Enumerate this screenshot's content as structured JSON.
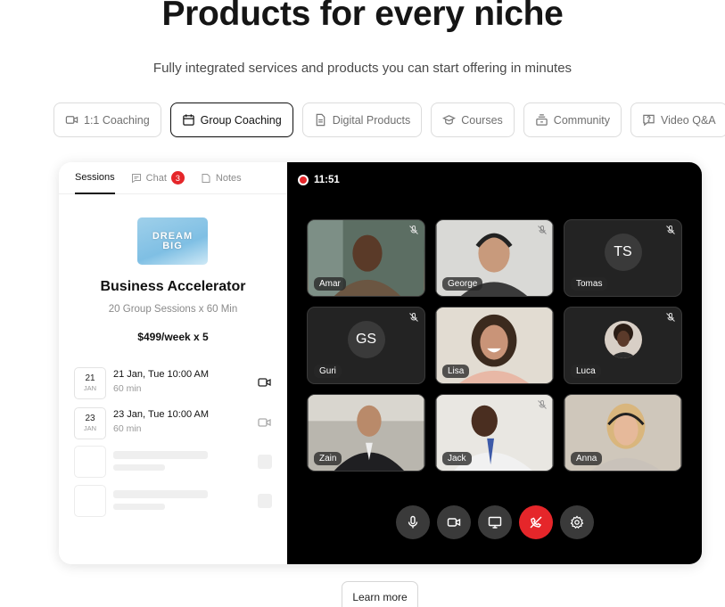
{
  "header": {
    "title": "Products for every niche",
    "subtitle": "Fully integrated services and products you can start offering in minutes"
  },
  "product_tabs": [
    {
      "label": "1:1 Coaching",
      "icon": "video-camera-icon",
      "active": false
    },
    {
      "label": "Group Coaching",
      "icon": "calendar-icon",
      "active": true
    },
    {
      "label": "Digital Products",
      "icon": "document-icon",
      "active": false
    },
    {
      "label": "Courses",
      "icon": "graduation-cap-icon",
      "active": false
    },
    {
      "label": "Community",
      "icon": "community-icon",
      "active": false
    },
    {
      "label": "Video Q&A",
      "icon": "question-chat-icon",
      "active": false
    }
  ],
  "panel": {
    "tabs": {
      "sessions": "Sessions",
      "chat": "Chat",
      "chat_badge": "3",
      "notes": "Notes"
    },
    "product": {
      "thumbnail_text": "DREAM BIG",
      "title": "Business Accelerator",
      "meta": "20 Group Sessions x 60 Min",
      "price": "$499/week x 5"
    },
    "sessions": [
      {
        "day": "21",
        "month": "JAN",
        "time": "21 Jan, Tue 10:00 AM",
        "duration": "60 min"
      },
      {
        "day": "23",
        "month": "JAN",
        "time": "23 Jan, Tue 10:00 AM",
        "duration": "60 min"
      }
    ]
  },
  "call": {
    "timer": "11:51",
    "participants": [
      {
        "name": "Amar",
        "type": "video"
      },
      {
        "name": "George",
        "type": "video"
      },
      {
        "name": "Tomas",
        "type": "initials",
        "initials": "TS"
      },
      {
        "name": "Guri",
        "type": "initials",
        "initials": "GS"
      },
      {
        "name": "Lisa",
        "type": "video"
      },
      {
        "name": "Luca",
        "type": "avatar"
      },
      {
        "name": "Zain",
        "type": "video"
      },
      {
        "name": "Jack",
        "type": "video"
      },
      {
        "name": "Anna",
        "type": "video"
      }
    ],
    "controls": [
      "microphone-icon",
      "camera-icon",
      "screen-share-icon",
      "end-call-icon",
      "settings-icon"
    ],
    "colors": {
      "end_call": "#e5262a",
      "recording": "#e5262a"
    }
  },
  "cta": {
    "learn_more": "Learn more"
  }
}
